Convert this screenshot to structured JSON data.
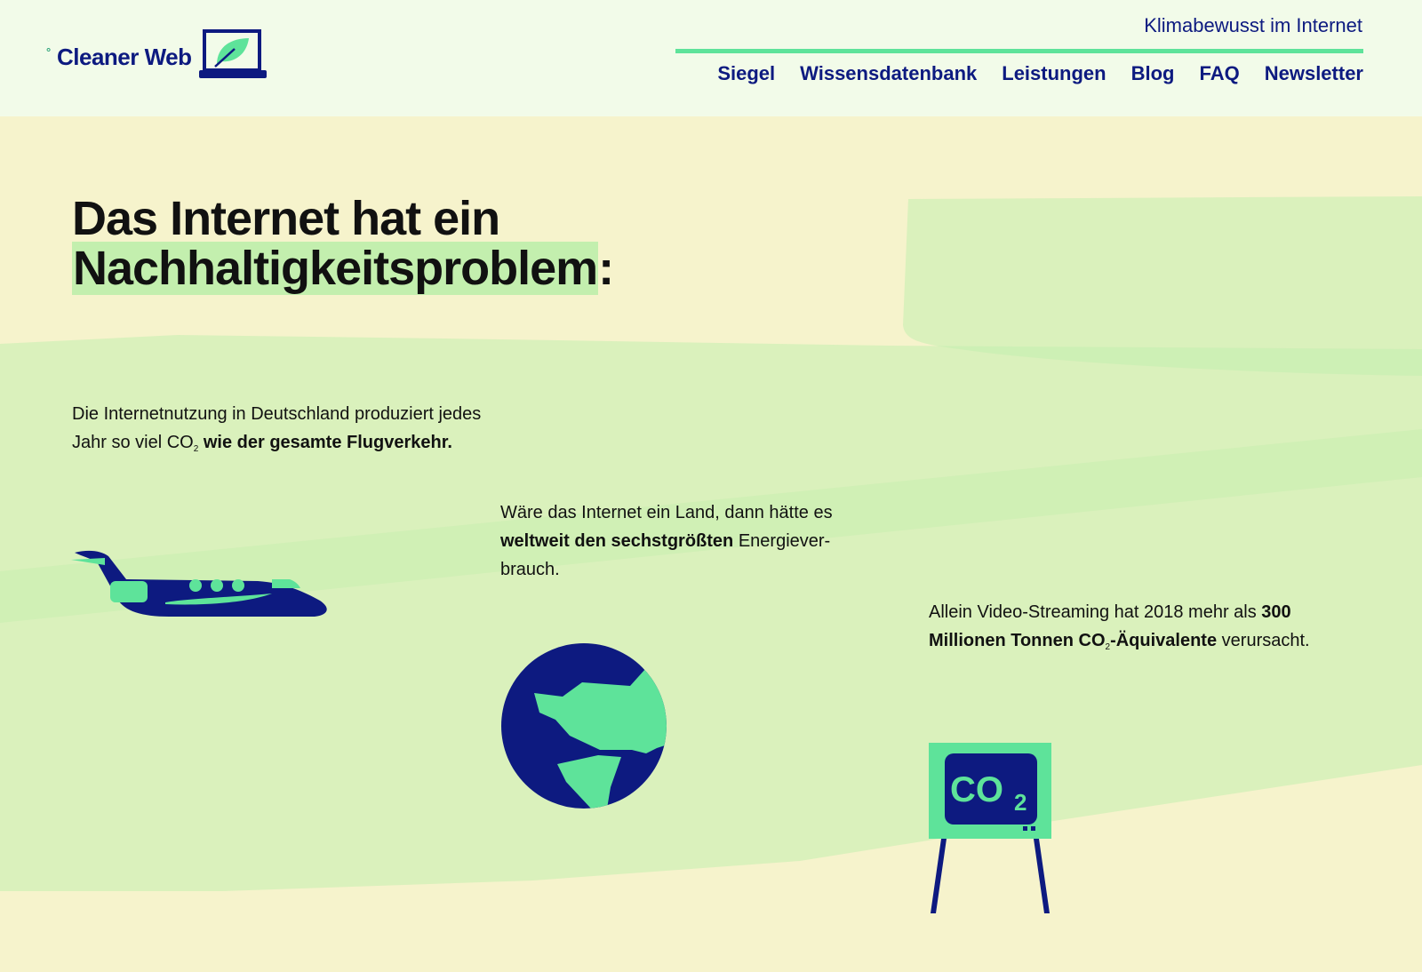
{
  "header": {
    "logo_prefix": "°",
    "logo_text": "Cleaner Web",
    "tagline": "Klimabewusst im Internet",
    "nav": [
      {
        "label": "Siegel"
      },
      {
        "label": "Wissensdatenbank"
      },
      {
        "label": "Leistungen"
      },
      {
        "label": "Blog"
      },
      {
        "label": "FAQ"
      },
      {
        "label": "Newsletter"
      }
    ]
  },
  "main": {
    "title_line1": "Das Internet hat ein",
    "title_highlight": "Nachhaltigkeitsproblem",
    "title_colon": ":",
    "facts": [
      {
        "p1": "Die Internetnutzung in Deutschland produziert jedes Jahr so viel CO",
        "sub": "2",
        "bold": "wie der gesamte Flugverkehr."
      },
      {
        "p1": "Wäre das Internet ein Land, dann hätte es",
        "bold": "weltweit den sechstgrößten",
        "p2": "Energiever-brauch."
      },
      {
        "p1": "Allein Video-Streaming hat 2018 mehr als",
        "bold1": "300 Millionen Tonnen CO",
        "sub": "2",
        "bold2": "-Äquivalente",
        "p2": "verursacht."
      }
    ],
    "tv_screen_text": "CO",
    "tv_screen_sub": "2"
  },
  "icons": [
    "laptop-leaf-icon",
    "airplane-icon",
    "globe-icon",
    "tv-co2-icon"
  ],
  "colors": {
    "navy": "#0d1a80",
    "mint": "#5ee39a",
    "header_bg": "#f2fbe9",
    "page_bg": "#f6f3cc",
    "band_green": "#c3efae"
  }
}
